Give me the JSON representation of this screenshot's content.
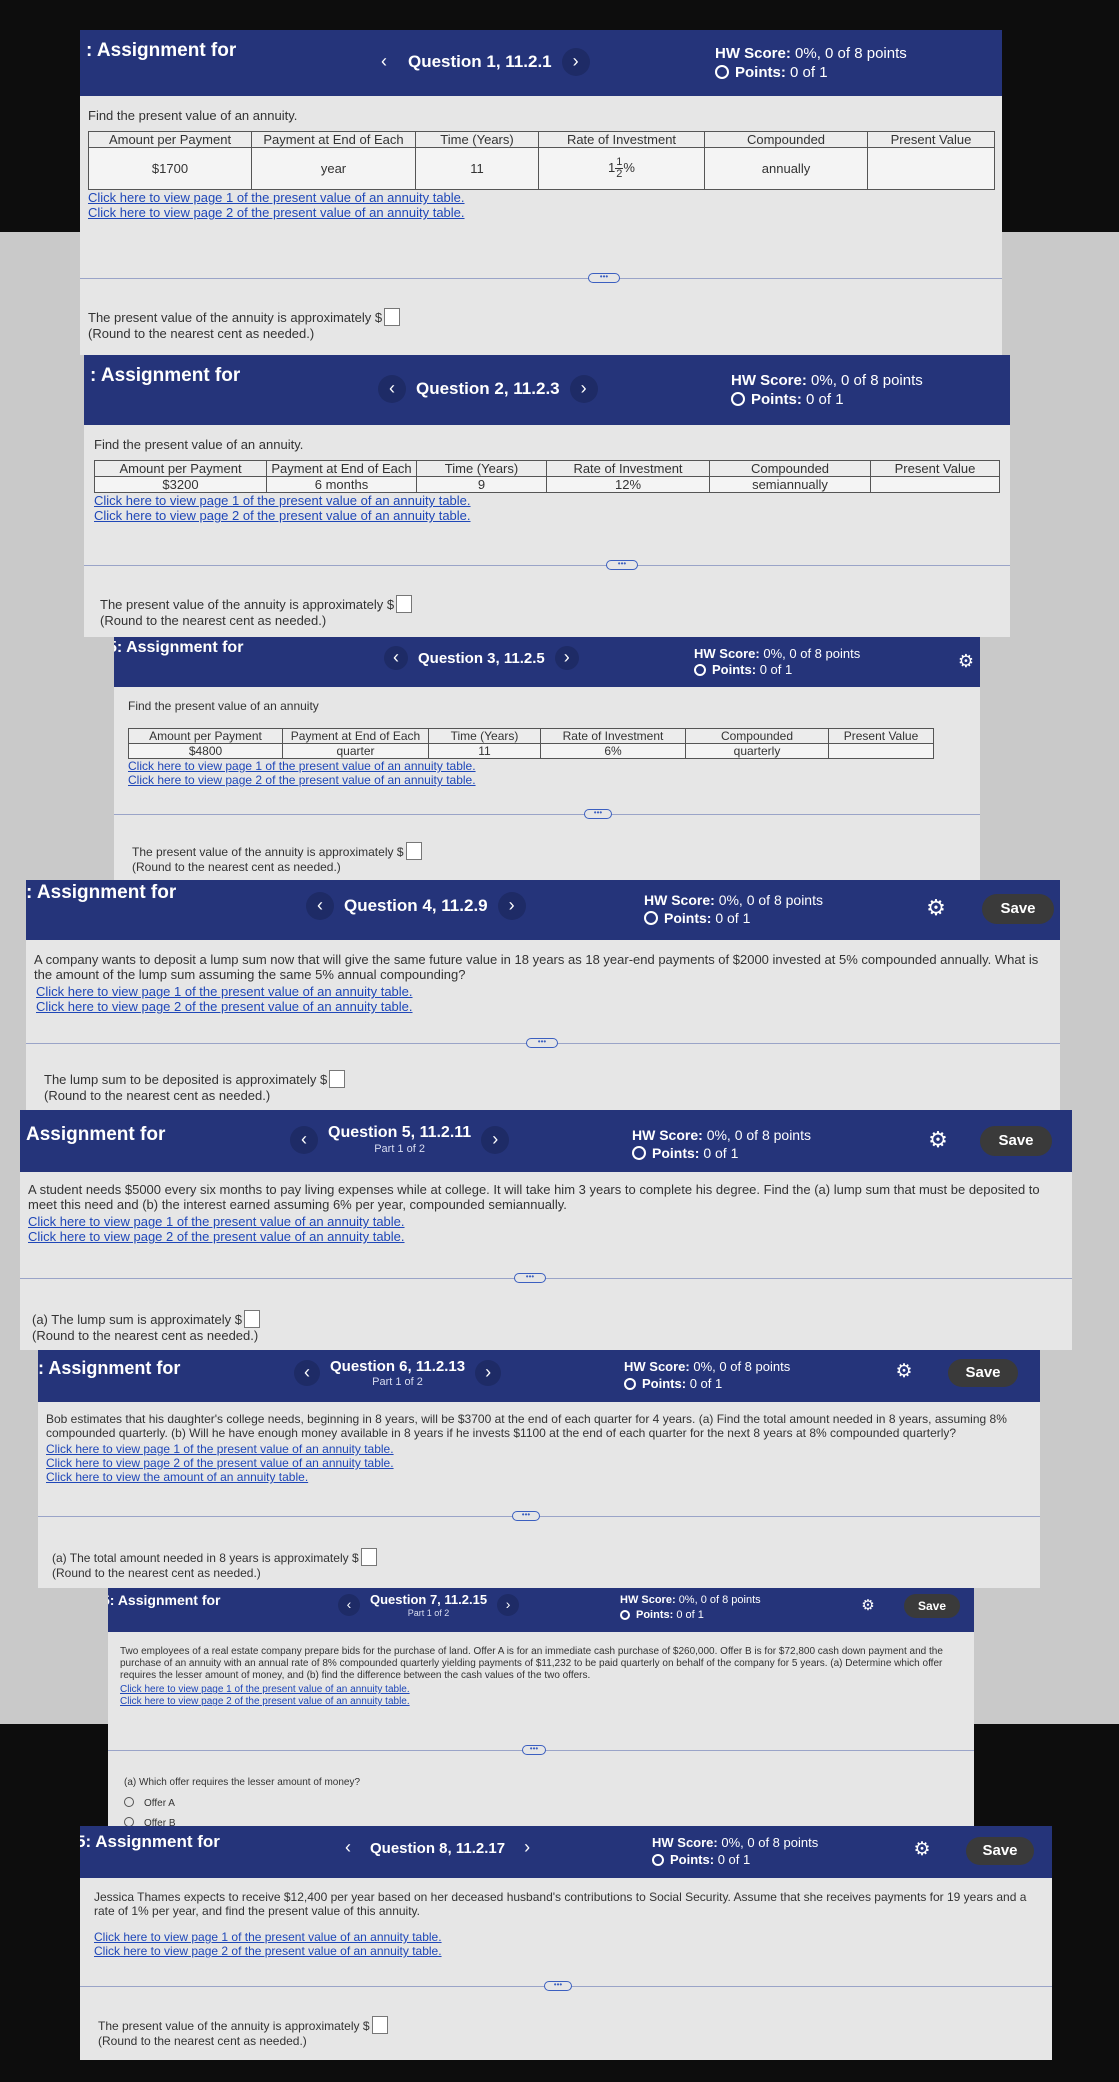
{
  "common": {
    "assignment_title": ": Assignment for",
    "hw_label": "HW Score:",
    "hw_value": "0%, 0 of 8 points",
    "points_label": "Points:",
    "points_value": "0 of 1",
    "save_label": "Save",
    "prev_glyph": "‹",
    "next_glyph": "›",
    "dots_glyph": "•••",
    "link_page1": "Click here to view page 1 of the present value of an annuity table.",
    "link_page2": "Click here to view page 2 of the present value of an annuity table.",
    "round_note": "(Round to the nearest cent as needed.)",
    "pv_answer": "The present value of the annuity is approximately $",
    "find_pv": "Find the present value of an annuity."
  },
  "table_headers": [
    "Amount per Payment",
    "Payment at End of Each",
    "Time (Years)",
    "Rate of Investment",
    "Compounded",
    "Present Value"
  ],
  "q1": {
    "assignment_title": ": Assignment for",
    "title": "Question 1, 11.2.1",
    "row": {
      "amount": "$1700",
      "period": "year",
      "time": "11",
      "rate_whole": "1",
      "rate_num": "1",
      "rate_den": "2",
      "rate_pct": "%",
      "compounded": "annually"
    }
  },
  "q2": {
    "title": "Question 2, 11.2.3",
    "row": {
      "amount": "$3200",
      "period": "6 months",
      "time": "9",
      "rate": "12%",
      "compounded": "semiannually"
    }
  },
  "q3": {
    "assignment_title": "5: Assignment for",
    "title": "Question 3, 11.2.5",
    "prompt": "Find the present value of an annuity",
    "row": {
      "amount": "$4800",
      "period": "quarter",
      "time": "11",
      "rate": "6%",
      "compounded": "quarterly"
    }
  },
  "q4": {
    "title": "Question 4, 11.2.9",
    "prompt": "A company wants to deposit a lump sum now that will give the same future value in 18 years as 18 year-end payments of $2000 invested at 5% compounded annually. What is the amount of the lump sum assuming the same 5% annual compounding?",
    "answer": "The lump sum to be deposited is approximately $"
  },
  "q5": {
    "assignment_title": "Assignment for",
    "title": "Question 5, 11.2.11",
    "part": "Part 1 of 2",
    "prompt": "A student needs $5000 every six months to pay living expenses while at college. It will take him 3 years to complete his degree. Find the (a) lump sum that must be deposited to meet this need and (b) the interest earned assuming 6% per year, compounded semiannually.",
    "answer": "(a) The lump sum is approximately $"
  },
  "q6": {
    "title": "Question 6, 11.2.13",
    "part": "Part 1 of 2",
    "prompt": "Bob estimates that his daughter's college needs, beginning in 8 years, will be $3700 at the end of each quarter for 4 years. (a) Find the total amount needed in 8 years, assuming 8% compounded quarterly. (b) Will he have enough money available in 8 years if he invests $1100 at the end of each quarter for the next 8 years at 8% compounded quarterly?",
    "link_fv": "Click here to view the amount of an annuity table.",
    "answer": "(a) The total amount needed in 8 years is approximately $"
  },
  "q7": {
    "assignment_title": "5: Assignment for",
    "title": "Question 7, 11.2.15",
    "part": "Part 1 of 2",
    "prompt": "Two employees of a real estate company prepare bids for the purchase of land. Offer A is for an immediate cash purchase of $260,000. Offer B is for $72,800 cash down payment and the purchase of an annuity with an annual rate of 8% compounded quarterly yielding payments of $11,232 to be paid quarterly on behalf of the company for 5 years. (a) Determine which offer requires the lesser amount of money, and (b) find the difference between the cash values of the two offers.",
    "question": "(a) Which offer requires the lesser amount of money?",
    "options": [
      "Offer A",
      "Offer B"
    ]
  },
  "q8": {
    "assignment_title": "5: Assignment for",
    "title": "Question 8, 11.2.17",
    "prompt": "Jessica Thames expects to receive $12,400 per year based on her deceased husband's contributions to Social Security. Assume that she receives payments for 19 years and a rate of 1% per year, and find the present value of this annuity."
  }
}
